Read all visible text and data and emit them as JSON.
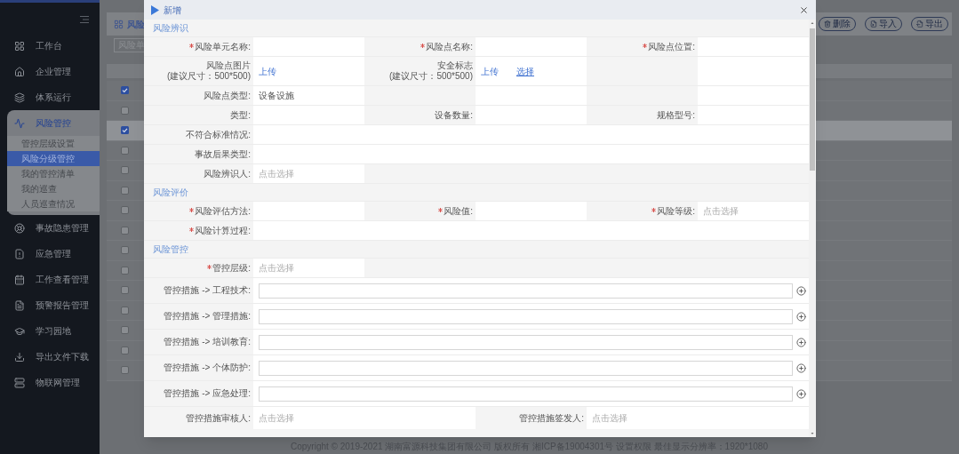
{
  "sidebar": {
    "items": [
      {
        "label": "工作台",
        "selected": false
      },
      {
        "label": "企业管理",
        "selected": false
      },
      {
        "label": "体系运行",
        "selected": false
      },
      {
        "label": "风险管控",
        "selected": true,
        "expanded": true,
        "children": [
          {
            "label": "管控层级设置",
            "selected": false
          },
          {
            "label": "风险分级管控",
            "selected": true
          },
          {
            "label": "我的管控清单",
            "selected": false
          },
          {
            "label": "我的巡查",
            "selected": false
          },
          {
            "label": "人员巡查情况",
            "selected": false
          }
        ]
      },
      {
        "label": "事故隐患管理",
        "selected": false
      },
      {
        "label": "应急管理",
        "selected": false
      },
      {
        "label": "工作查看管理",
        "selected": false
      },
      {
        "label": "预警报告管理",
        "selected": false
      },
      {
        "label": "学习园地",
        "selected": false
      },
      {
        "label": "导出文件下载",
        "selected": false
      },
      {
        "label": "物联网管理",
        "selected": false
      }
    ]
  },
  "page": {
    "title": "风险",
    "search": {
      "placeholder": "风险单"
    },
    "buttons": [
      "删除",
      "导入",
      "导出"
    ],
    "table_rows": [
      {
        "checked": true,
        "selected": false
      },
      {
        "checked": false,
        "selected": false
      },
      {
        "checked": true,
        "selected": true
      },
      {
        "checked": false,
        "selected": false
      },
      {
        "checked": false,
        "selected": false
      },
      {
        "checked": false,
        "selected": false
      },
      {
        "checked": false,
        "selected": false
      },
      {
        "checked": false,
        "selected": false
      },
      {
        "checked": false,
        "selected": false
      },
      {
        "checked": false,
        "selected": false
      },
      {
        "checked": false,
        "selected": false
      },
      {
        "checked": false,
        "selected": false
      },
      {
        "checked": false,
        "selected": false
      },
      {
        "checked": false,
        "selected": false
      },
      {
        "checked": false,
        "selected": false
      }
    ]
  },
  "footer": {
    "copyright": "Copyright © 2019-2021 湖南富源科技集团有限公司 版权所有 湘ICP备19004301号 设置权限 最佳显示分辨率：1920*1080"
  },
  "dialog": {
    "title": "新增",
    "sections": [
      {
        "title": "风险辨识",
        "rows": [
          {
            "kind": "three",
            "fields": [
              {
                "label": "风险单元名称:",
                "required": true,
                "kind": "input"
              },
              {
                "label": "风险点名称:",
                "required": true,
                "kind": "input"
              },
              {
                "label": "风险点位置:",
                "required": true,
                "kind": "input"
              }
            ]
          },
          {
            "kind": "three",
            "fields": [
              {
                "label": "风险点图片",
                "hint": "(建议尺寸：500*500)",
                "required": false,
                "kind": "upload",
                "links": [
                  {
                    "label": "上传",
                    "kind": "upload"
                  }
                ]
              },
              {
                "label": "安全标志",
                "hint": "(建议尺寸：500*500)",
                "required": false,
                "kind": "upload",
                "links": [
                  {
                    "label": "上传",
                    "kind": "upload"
                  },
                  {
                    "label": "选择",
                    "kind": "pick"
                  }
                ]
              },
              {
                "kind": "blank"
              }
            ]
          },
          {
            "kind": "three",
            "fields": [
              {
                "label": "风险点类型:",
                "required": false,
                "kind": "text",
                "value": "设备设施"
              },
              {
                "kind": "blank"
              },
              {
                "kind": "blank"
              }
            ]
          },
          {
            "kind": "three",
            "fields": [
              {
                "label": "类型:",
                "required": false,
                "kind": "input"
              },
              {
                "label": "设备数量:",
                "required": false,
                "kind": "input"
              },
              {
                "label": "规格型号:",
                "required": false,
                "kind": "input"
              }
            ]
          },
          {
            "kind": "wide",
            "fields": [
              {
                "label": "不符合标准情况:",
                "required": false,
                "kind": "input"
              }
            ]
          },
          {
            "kind": "wide",
            "fields": [
              {
                "label": "事故后果类型:",
                "required": false,
                "kind": "input"
              }
            ]
          },
          {
            "kind": "three",
            "fields": [
              {
                "label": "风险辨识人:",
                "required": false,
                "kind": "select",
                "placeholder": "点击选择"
              }
            ]
          }
        ]
      },
      {
        "title": "风险评价",
        "rows": [
          {
            "kind": "three",
            "fields": [
              {
                "label": "风险评估方法:",
                "required": true,
                "kind": "input"
              },
              {
                "label": "风险值:",
                "required": true,
                "kind": "input"
              },
              {
                "label": "风险等级:",
                "required": true,
                "kind": "select",
                "placeholder": "点击选择"
              }
            ]
          },
          {
            "kind": "wide",
            "fields": [
              {
                "label": "风险计算过程:",
                "required": true,
                "kind": "input"
              }
            ]
          }
        ]
      },
      {
        "title": "风险管控",
        "rows": [
          {
            "kind": "three",
            "fields": [
              {
                "label": "管控层级:",
                "required": true,
                "kind": "select",
                "placeholder": "点击选择"
              }
            ]
          },
          {
            "kind": "measure",
            "fields": [
              {
                "label": "管控措施 -> 工程技术:",
                "required": false,
                "kind": "input"
              }
            ]
          },
          {
            "kind": "measure",
            "fields": [
              {
                "label": "管控措施 -> 管理措施:",
                "required": false,
                "kind": "input"
              }
            ]
          },
          {
            "kind": "measure",
            "fields": [
              {
                "label": "管控措施 -> 培训教育:",
                "required": false,
                "kind": "input"
              }
            ]
          },
          {
            "kind": "measure",
            "fields": [
              {
                "label": "管控措施 -> 个体防护:",
                "required": false,
                "kind": "input"
              }
            ]
          },
          {
            "kind": "measure",
            "fields": [
              {
                "label": "管控措施 -> 应急处理:",
                "required": false,
                "kind": "input"
              }
            ]
          },
          {
            "kind": "two",
            "fields": [
              {
                "label": "管控措施审核人:",
                "required": false,
                "kind": "select",
                "placeholder": "点击选择"
              },
              {
                "label": "管控措施签发人:",
                "required": false,
                "kind": "select",
                "placeholder": "点击选择"
              }
            ]
          }
        ]
      }
    ]
  }
}
